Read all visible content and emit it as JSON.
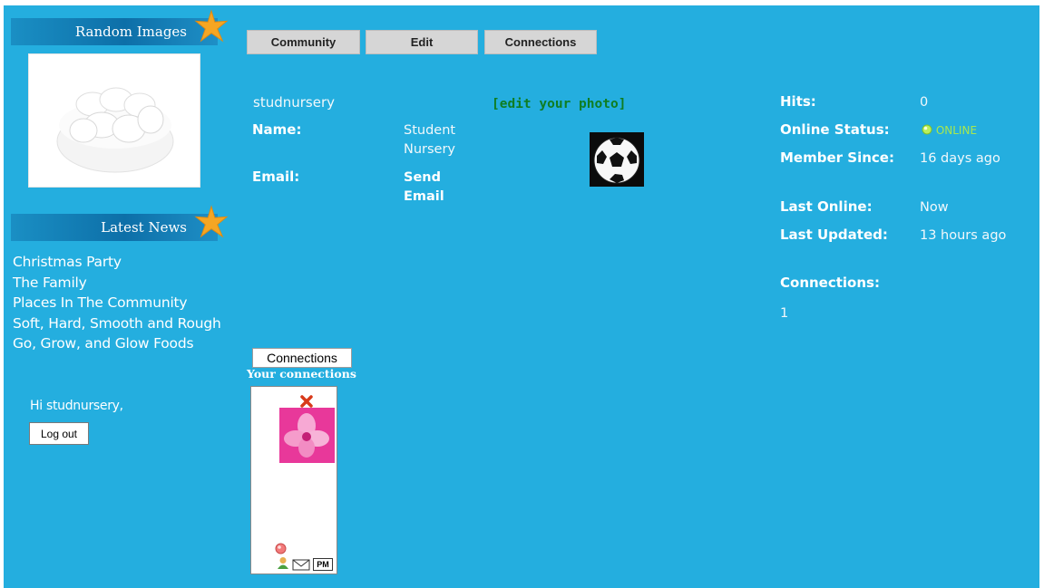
{
  "sidebar": {
    "random_images_heading": "Random Images",
    "latest_news_heading": "Latest News",
    "news": [
      "Christmas Party",
      "The Family",
      "Places In The Community",
      "Soft, Hard, Smooth and Rough",
      "Go, Grow, and Glow Foods"
    ],
    "greeting": "Hi studnursery,",
    "logout_label": "Log out"
  },
  "tabs": [
    "Community",
    "Edit",
    "Connections"
  ],
  "profile": {
    "username": "studnursery",
    "name_label": "Name:",
    "name_value": "Student Nursery",
    "email_label": "Email:",
    "email_value": "Send Email",
    "edit_photo": "[edit your photo]"
  },
  "stats": {
    "hits_label": "Hits:",
    "hits_value": "0",
    "online_label": "Online Status:",
    "online_value": "ONLINE",
    "member_since_label": "Member Since:",
    "member_since_value": "16 days ago",
    "last_online_label": "Last Online:",
    "last_online_value": "Now",
    "last_updated_label": "Last Updated:",
    "last_updated_value": "13 hours ago",
    "connections_label": "Connections:",
    "connections_value": "1"
  },
  "connections": {
    "title": "Connections",
    "subtitle": "Your connections",
    "pm_label": "PM"
  },
  "colors": {
    "background": "#24aedf",
    "edit_link": "#0f7d22",
    "online": "#a8e84e"
  }
}
